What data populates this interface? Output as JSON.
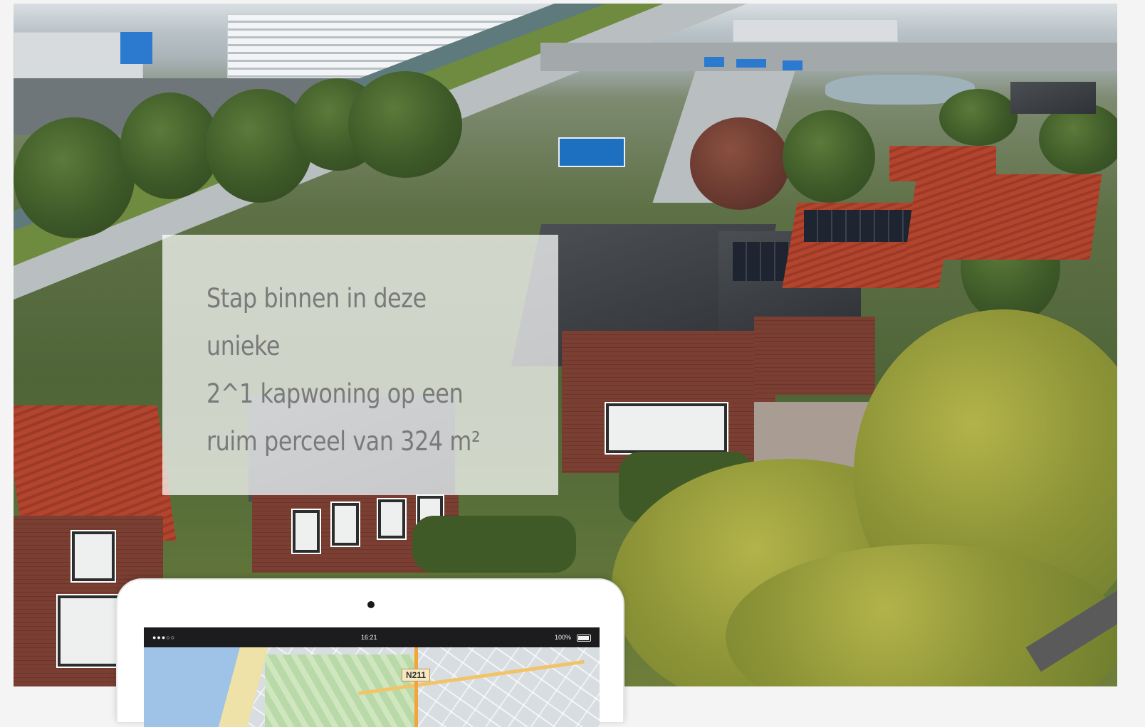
{
  "hero": {
    "headline": "Stap binnen in deze unieke\n2^1 kapwoning op een\nruim perceel van 324 m²",
    "photo_description_icon": "aerial-photo"
  },
  "device": {
    "status_signal": "●●●○○",
    "status_time": "16:21",
    "status_battery": "100%",
    "map_road_label": "N211"
  },
  "colors": {
    "overlay": "#ffffffb8",
    "headline_text": "#7a7a7a",
    "sign_blue": "#1d6fc0"
  }
}
